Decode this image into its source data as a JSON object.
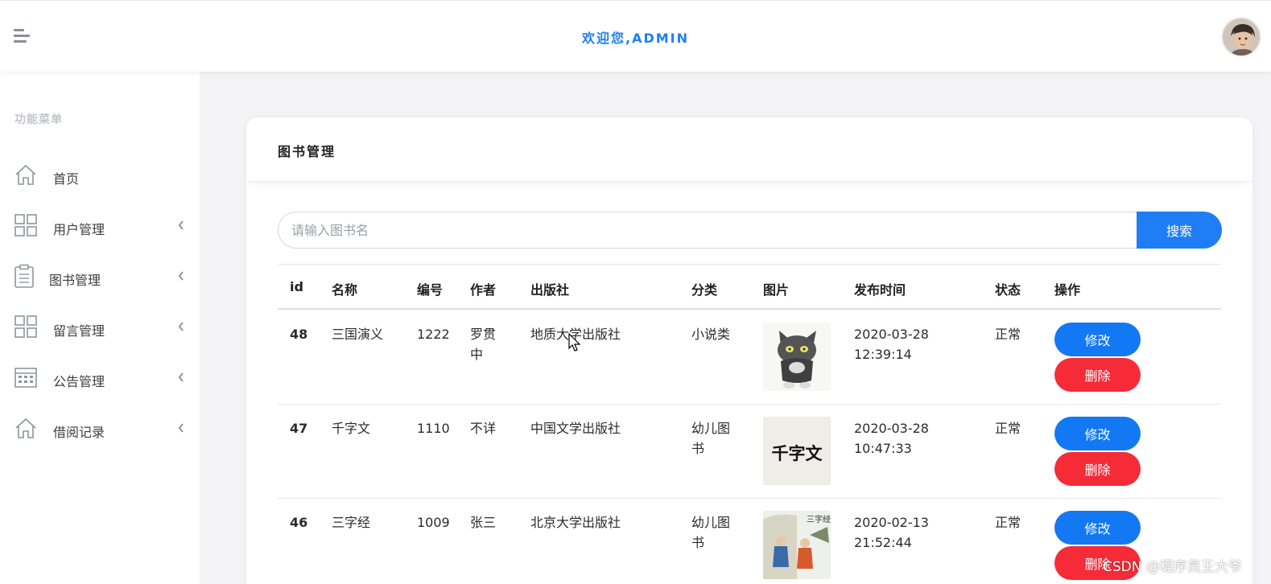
{
  "header": {
    "welcome": "欢迎您,ADMIN"
  },
  "sidebar": {
    "title": "功能菜单",
    "items": [
      {
        "label": "首页",
        "icon": "home-icon",
        "expandable": false
      },
      {
        "label": "用户管理",
        "icon": "grid-icon",
        "expandable": true
      },
      {
        "label": "图书管理",
        "icon": "clipboard-icon",
        "expandable": true
      },
      {
        "label": "留言管理",
        "icon": "grid-icon",
        "expandable": true
      },
      {
        "label": "公告管理",
        "icon": "calendar-icon",
        "expandable": true
      },
      {
        "label": "借阅记录",
        "icon": "home-icon",
        "expandable": true
      }
    ]
  },
  "card": {
    "title": "图书管理"
  },
  "search": {
    "placeholder": "请输入图书名",
    "value": "",
    "button_label": "搜索"
  },
  "table": {
    "headers": [
      "id",
      "名称",
      "编号",
      "作者",
      "出版社",
      "分类",
      "图片",
      "发布时间",
      "状态",
      "操作"
    ],
    "rows": [
      {
        "id": "48",
        "name": "三国演义",
        "code": "1222",
        "author": "罗贯中",
        "publisher": "地质大学出版社",
        "category": "小说类",
        "image": "cartoon-cat-image",
        "time": "2020-03-28 12:39:14",
        "status": "正常",
        "edit_label": "修改",
        "delete_label": "删除"
      },
      {
        "id": "47",
        "name": "千字文",
        "code": "1110",
        "author": "不详",
        "publisher": "中国文学出版社",
        "category": "幼儿图书",
        "image": "calligraphy-qianziwen-image",
        "image_text": "千字文",
        "time": "2020-03-28 10:47:33",
        "status": "正常",
        "edit_label": "修改",
        "delete_label": "删除"
      },
      {
        "id": "46",
        "name": "三字经",
        "code": "1009",
        "author": "张三",
        "publisher": "北京大学出版社",
        "category": "幼儿图书",
        "image": "sanzijing-painting-image",
        "image_text": "三字经",
        "time": "2020-02-13 21:52:44",
        "status": "正常",
        "edit_label": "修改",
        "delete_label": "删除"
      }
    ]
  },
  "watermark": "CSDN @程序员王大爷",
  "colors": {
    "primary": "#1f7ef5",
    "danger": "#f62b38",
    "sidebar_bg": "#ffffff",
    "page_bg": "#f4f4f6"
  }
}
